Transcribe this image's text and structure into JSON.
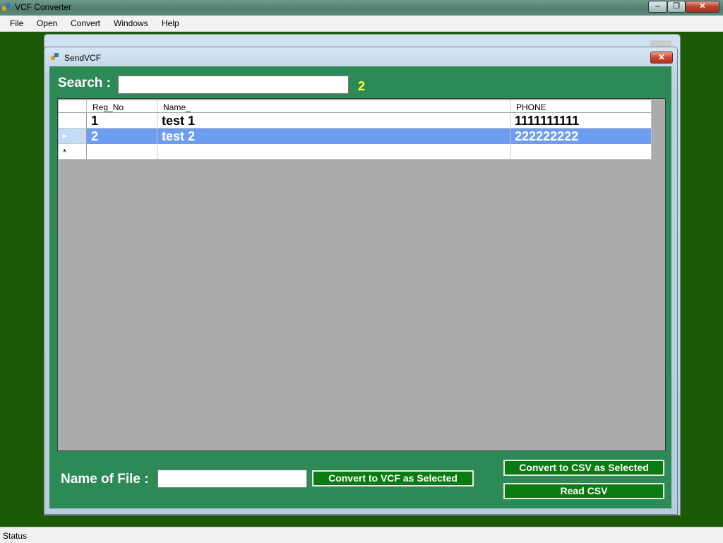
{
  "window": {
    "title": "VCF Converter"
  },
  "menu": [
    "File",
    "Open",
    "Convert",
    "Windows",
    "Help"
  ],
  "child_window": {
    "title": "SendVCF",
    "close_label": "✕"
  },
  "search": {
    "label": "Search :",
    "value": "",
    "result_count": "2"
  },
  "grid": {
    "columns": [
      "Reg_No",
      "Name_",
      "PHONE"
    ],
    "rows": [
      {
        "reg_no": "1",
        "name": "test 1",
        "phone": "1111111111",
        "selected": false
      },
      {
        "reg_no": "2",
        "name": "test 2",
        "phone": "222222222",
        "selected": true
      }
    ],
    "new_row_marker": "*",
    "current_row_marker": "▸"
  },
  "file": {
    "label": "Name of File :",
    "value": ""
  },
  "buttons": {
    "convert_vcf": "Convert to VCF as Selected",
    "convert_csv": "Convert to CSV as Selected",
    "read_csv": "Read CSV"
  },
  "status": {
    "text": "Status"
  },
  "colors": {
    "form_bg": "#2d8a57",
    "selection": "#6c9df0",
    "count": "#ffff33",
    "button_bg": "#0b7a10"
  }
}
